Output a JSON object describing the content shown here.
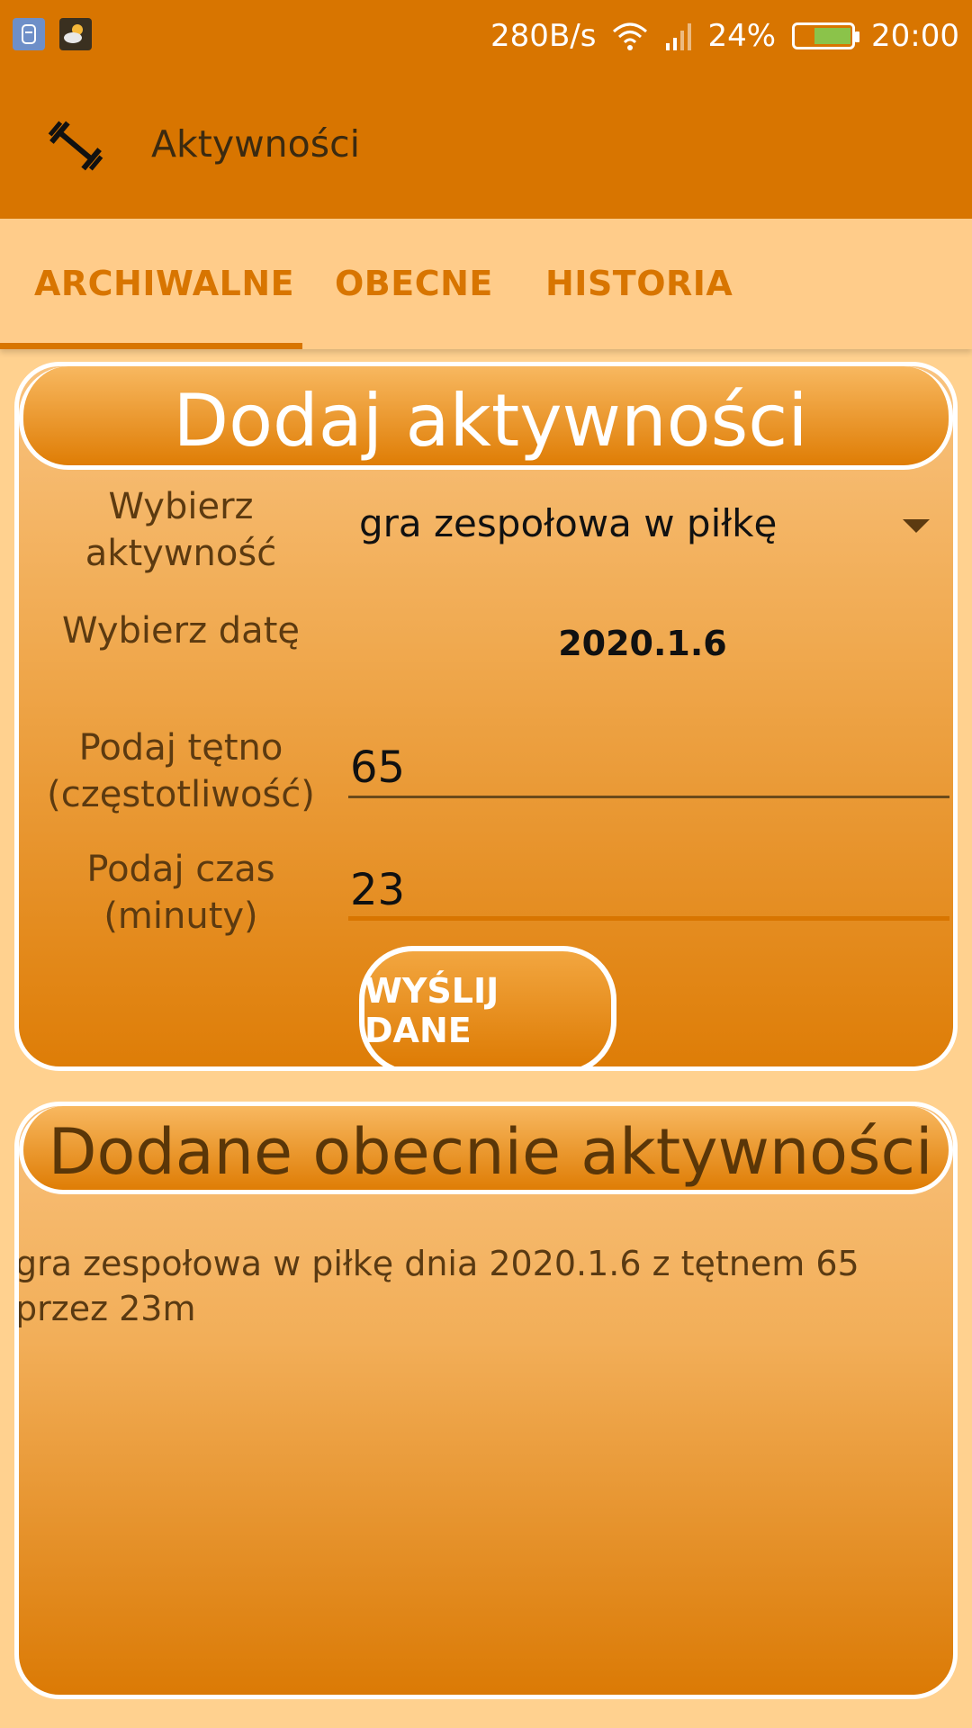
{
  "statusbar": {
    "speed": "280B/s",
    "battery_pct": "24%",
    "time": "20:00",
    "battery_level": 0.24
  },
  "appbar": {
    "icon": "dumbbell-icon",
    "title": "Aktywności"
  },
  "tabs": [
    {
      "label": "ARCHIWALNE",
      "selected": true
    },
    {
      "label": "OBECNE",
      "selected": false
    },
    {
      "label": "HISTORIA",
      "selected": false
    }
  ],
  "form": {
    "title": "Dodaj aktywności",
    "activity_label": "Wybierz aktywność",
    "activity_value": "gra zespołowa w piłkę",
    "date_label": "Wybierz datę",
    "date_value": "2020.1.6",
    "pulse_label": "Podaj tętno (częstotliwość)",
    "pulse_value": "65",
    "time_label": "Podaj czas (minuty)",
    "time_value": "23",
    "submit_label": "WYŚLIJ DANE"
  },
  "added": {
    "title": "Dodane obecnie aktywności",
    "entry": "gra zespołowa w piłkę dnia 2020.1.6 z tętnem 65 przez 23m"
  },
  "colors": {
    "primary": "#D87500",
    "background": "#FFD18F",
    "accent_text": "#5C3A10"
  }
}
